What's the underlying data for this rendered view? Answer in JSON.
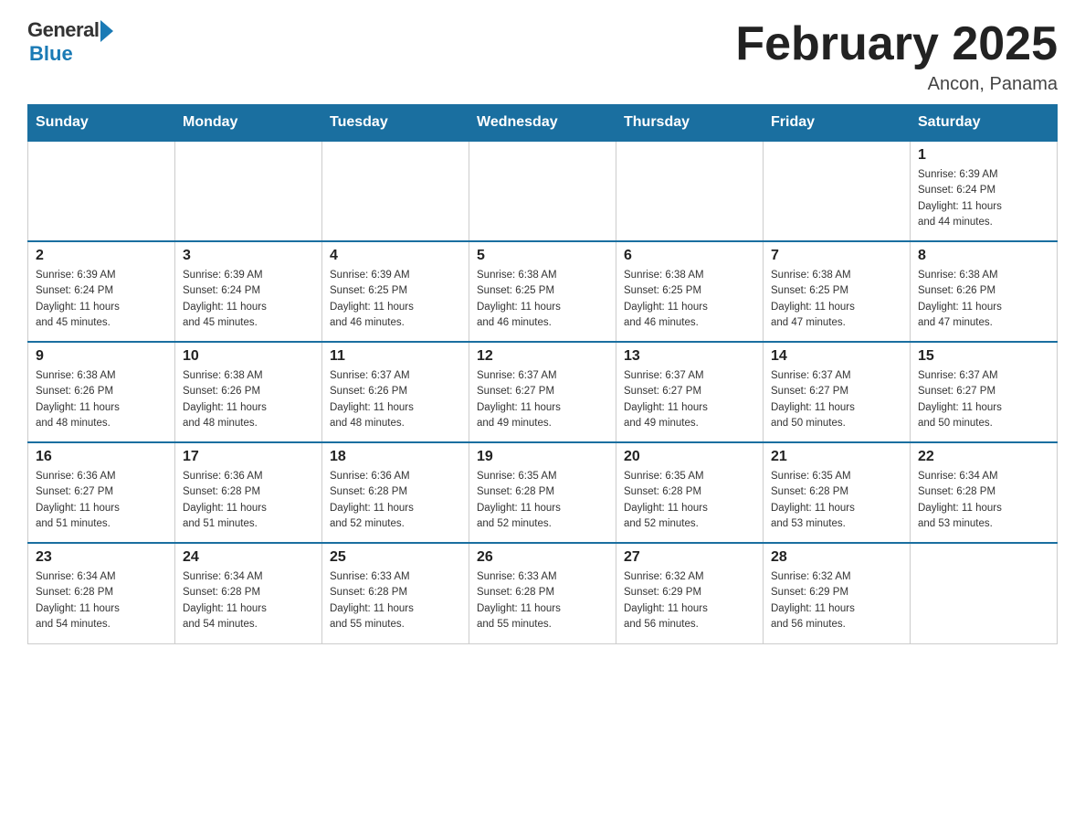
{
  "logo": {
    "general": "General",
    "blue": "Blue"
  },
  "title": "February 2025",
  "location": "Ancon, Panama",
  "days_of_week": [
    "Sunday",
    "Monday",
    "Tuesday",
    "Wednesday",
    "Thursday",
    "Friday",
    "Saturday"
  ],
  "weeks": [
    [
      {
        "day": "",
        "info": ""
      },
      {
        "day": "",
        "info": ""
      },
      {
        "day": "",
        "info": ""
      },
      {
        "day": "",
        "info": ""
      },
      {
        "day": "",
        "info": ""
      },
      {
        "day": "",
        "info": ""
      },
      {
        "day": "1",
        "info": "Sunrise: 6:39 AM\nSunset: 6:24 PM\nDaylight: 11 hours\nand 44 minutes."
      }
    ],
    [
      {
        "day": "2",
        "info": "Sunrise: 6:39 AM\nSunset: 6:24 PM\nDaylight: 11 hours\nand 45 minutes."
      },
      {
        "day": "3",
        "info": "Sunrise: 6:39 AM\nSunset: 6:24 PM\nDaylight: 11 hours\nand 45 minutes."
      },
      {
        "day": "4",
        "info": "Sunrise: 6:39 AM\nSunset: 6:25 PM\nDaylight: 11 hours\nand 46 minutes."
      },
      {
        "day": "5",
        "info": "Sunrise: 6:38 AM\nSunset: 6:25 PM\nDaylight: 11 hours\nand 46 minutes."
      },
      {
        "day": "6",
        "info": "Sunrise: 6:38 AM\nSunset: 6:25 PM\nDaylight: 11 hours\nand 46 minutes."
      },
      {
        "day": "7",
        "info": "Sunrise: 6:38 AM\nSunset: 6:25 PM\nDaylight: 11 hours\nand 47 minutes."
      },
      {
        "day": "8",
        "info": "Sunrise: 6:38 AM\nSunset: 6:26 PM\nDaylight: 11 hours\nand 47 minutes."
      }
    ],
    [
      {
        "day": "9",
        "info": "Sunrise: 6:38 AM\nSunset: 6:26 PM\nDaylight: 11 hours\nand 48 minutes."
      },
      {
        "day": "10",
        "info": "Sunrise: 6:38 AM\nSunset: 6:26 PM\nDaylight: 11 hours\nand 48 minutes."
      },
      {
        "day": "11",
        "info": "Sunrise: 6:37 AM\nSunset: 6:26 PM\nDaylight: 11 hours\nand 48 minutes."
      },
      {
        "day": "12",
        "info": "Sunrise: 6:37 AM\nSunset: 6:27 PM\nDaylight: 11 hours\nand 49 minutes."
      },
      {
        "day": "13",
        "info": "Sunrise: 6:37 AM\nSunset: 6:27 PM\nDaylight: 11 hours\nand 49 minutes."
      },
      {
        "day": "14",
        "info": "Sunrise: 6:37 AM\nSunset: 6:27 PM\nDaylight: 11 hours\nand 50 minutes."
      },
      {
        "day": "15",
        "info": "Sunrise: 6:37 AM\nSunset: 6:27 PM\nDaylight: 11 hours\nand 50 minutes."
      }
    ],
    [
      {
        "day": "16",
        "info": "Sunrise: 6:36 AM\nSunset: 6:27 PM\nDaylight: 11 hours\nand 51 minutes."
      },
      {
        "day": "17",
        "info": "Sunrise: 6:36 AM\nSunset: 6:28 PM\nDaylight: 11 hours\nand 51 minutes."
      },
      {
        "day": "18",
        "info": "Sunrise: 6:36 AM\nSunset: 6:28 PM\nDaylight: 11 hours\nand 52 minutes."
      },
      {
        "day": "19",
        "info": "Sunrise: 6:35 AM\nSunset: 6:28 PM\nDaylight: 11 hours\nand 52 minutes."
      },
      {
        "day": "20",
        "info": "Sunrise: 6:35 AM\nSunset: 6:28 PM\nDaylight: 11 hours\nand 52 minutes."
      },
      {
        "day": "21",
        "info": "Sunrise: 6:35 AM\nSunset: 6:28 PM\nDaylight: 11 hours\nand 53 minutes."
      },
      {
        "day": "22",
        "info": "Sunrise: 6:34 AM\nSunset: 6:28 PM\nDaylight: 11 hours\nand 53 minutes."
      }
    ],
    [
      {
        "day": "23",
        "info": "Sunrise: 6:34 AM\nSunset: 6:28 PM\nDaylight: 11 hours\nand 54 minutes."
      },
      {
        "day": "24",
        "info": "Sunrise: 6:34 AM\nSunset: 6:28 PM\nDaylight: 11 hours\nand 54 minutes."
      },
      {
        "day": "25",
        "info": "Sunrise: 6:33 AM\nSunset: 6:28 PM\nDaylight: 11 hours\nand 55 minutes."
      },
      {
        "day": "26",
        "info": "Sunrise: 6:33 AM\nSunset: 6:28 PM\nDaylight: 11 hours\nand 55 minutes."
      },
      {
        "day": "27",
        "info": "Sunrise: 6:32 AM\nSunset: 6:29 PM\nDaylight: 11 hours\nand 56 minutes."
      },
      {
        "day": "28",
        "info": "Sunrise: 6:32 AM\nSunset: 6:29 PM\nDaylight: 11 hours\nand 56 minutes."
      },
      {
        "day": "",
        "info": ""
      }
    ]
  ]
}
